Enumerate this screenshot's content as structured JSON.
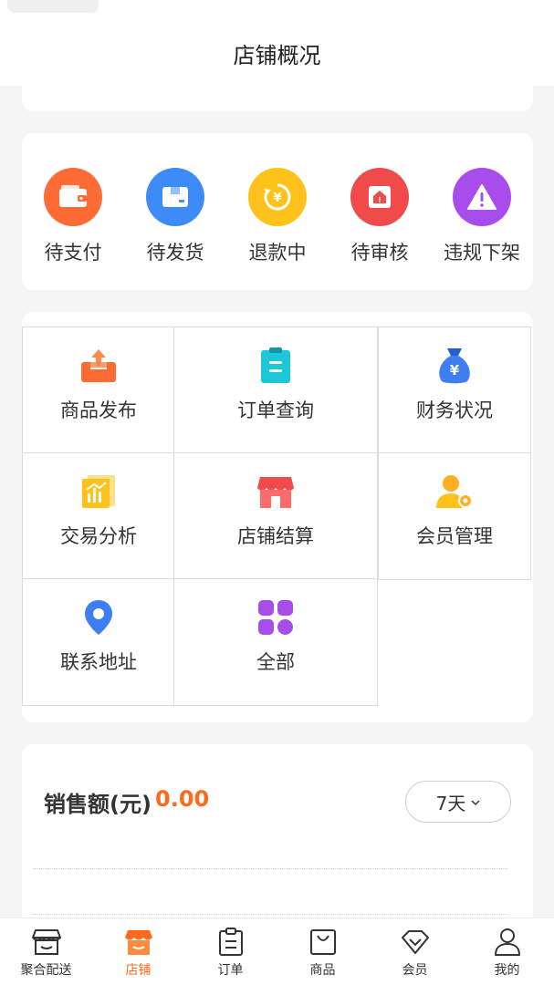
{
  "header": {
    "title": "店铺概况"
  },
  "status_items": [
    {
      "label": "待支付",
      "icon": "wallet-icon",
      "color": "#ff6b35"
    },
    {
      "label": "待发货",
      "icon": "package-icon",
      "color": "#3d8bf7"
    },
    {
      "label": "退款中",
      "icon": "refund-icon",
      "color": "#ffc21a"
    },
    {
      "label": "待审核",
      "icon": "review-icon",
      "color": "#f14a4a"
    },
    {
      "label": "违规下架",
      "icon": "warning-icon",
      "color": "#a94dea"
    }
  ],
  "grid_items": [
    {
      "label": "商品发布",
      "icon": "upload-icon"
    },
    {
      "label": "订单查询",
      "icon": "clipboard-icon"
    },
    {
      "label": "财务状况",
      "icon": "money-bag-icon"
    },
    {
      "label": "交易分析",
      "icon": "chart-icon"
    },
    {
      "label": "店铺结算",
      "icon": "store-icon"
    },
    {
      "label": "会员管理",
      "icon": "member-settings-icon"
    },
    {
      "label": "联系地址",
      "icon": "location-icon"
    },
    {
      "label": "全部",
      "icon": "grid-icon"
    }
  ],
  "sales": {
    "title": "销售额(元)",
    "value": "0.00",
    "range": "7天"
  },
  "tabs": [
    {
      "label": "聚合配送",
      "icon": "delivery-icon",
      "active": false
    },
    {
      "label": "店铺",
      "icon": "shop-icon",
      "active": true
    },
    {
      "label": "订单",
      "icon": "order-icon",
      "active": false
    },
    {
      "label": "商品",
      "icon": "bag-icon",
      "active": false
    },
    {
      "label": "会员",
      "icon": "vip-icon",
      "active": false
    },
    {
      "label": "我的",
      "icon": "user-icon",
      "active": false
    }
  ],
  "colors": {
    "accent": "#ff6a1a"
  }
}
